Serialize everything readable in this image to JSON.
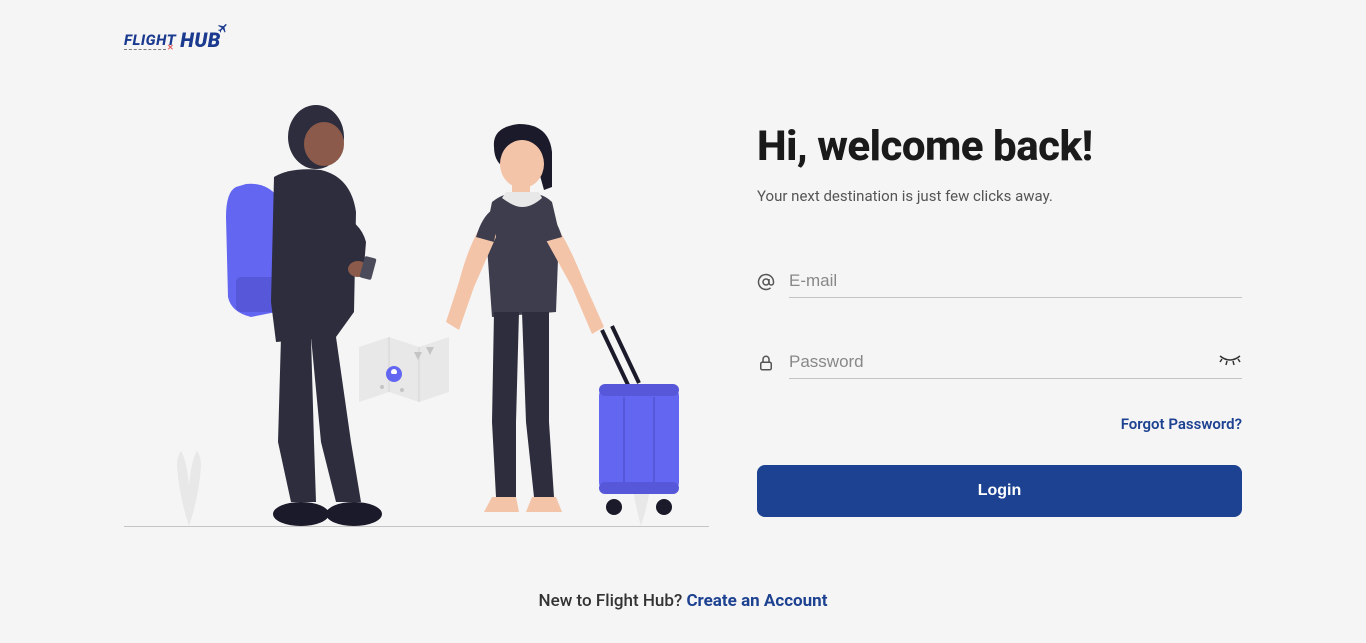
{
  "brand": {
    "flight_text": "FLIGHT",
    "hub_text": "HUB"
  },
  "login": {
    "title": "Hi, welcome back!",
    "subtitle": "Your next destination is just few clicks away.",
    "email_placeholder": "E-mail",
    "email_value": "",
    "password_placeholder": "Password",
    "password_value": "",
    "forgot_password": "Forgot Password?",
    "login_button": "Login"
  },
  "footer": {
    "prompt": "New to Flight Hub? ",
    "create_account": "Create an Account"
  },
  "colors": {
    "primary": "#1d4291",
    "accent_purple": "#6366f1",
    "text_dark": "#1a1a1a",
    "text_gray": "#555"
  }
}
